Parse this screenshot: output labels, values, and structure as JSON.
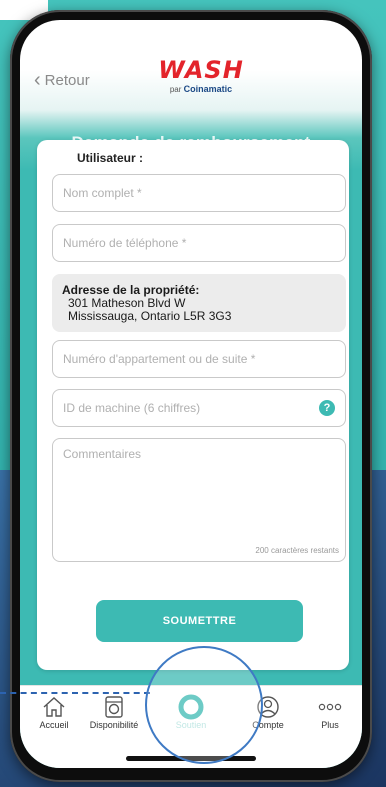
{
  "header": {
    "back_label": "Retour",
    "logo_brand": "WASH",
    "logo_sub_prefix": "par",
    "logo_sub_brand": "Coinamatic",
    "page_title": "Demande de remboursement"
  },
  "form": {
    "section_label": "Utilisateur :",
    "full_name_placeholder": "Nom complet *",
    "phone_placeholder": "Numéro de téléphone *",
    "address_title": "Adresse de la propriété:",
    "address_line1": "301 Matheson Blvd W",
    "address_line2": "Mississauga, Ontario L5R 3G3",
    "unit_placeholder": "Numéro d'appartement ou de suite *",
    "machine_id_placeholder": "ID de machine (6 chiffres)",
    "help_symbol": "?",
    "comments_placeholder": "Commentaires",
    "char_counter": "200 caractères restants",
    "submit_label": "SOUMETTRE"
  },
  "tabs": [
    {
      "label": "Accueil",
      "icon": "home-icon"
    },
    {
      "label": "Disponibilité",
      "icon": "washer-icon"
    },
    {
      "label": "Soutien",
      "icon": "lifebuoy-icon",
      "active": true
    },
    {
      "label": "Compte",
      "icon": "account-icon"
    },
    {
      "label": "Plus",
      "icon": "more-dots-icon"
    }
  ],
  "colors": {
    "accent": "#3dbab3",
    "brand_red": "#e3242b",
    "brand_blue": "#1c4a86"
  }
}
